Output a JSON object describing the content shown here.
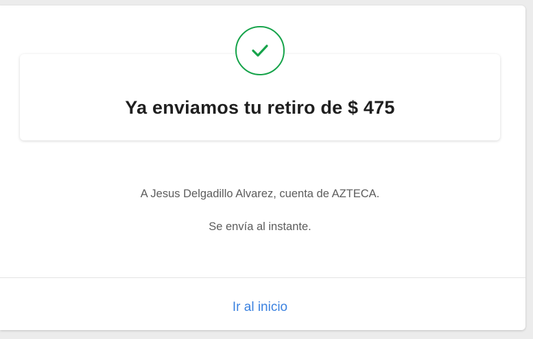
{
  "confirmation": {
    "status_icon": "check-icon",
    "title": "Ya enviamos tu retiro de $ 475",
    "recipient_text": "A Jesus Delgadillo Alvarez, cuenta de AZTECA.",
    "timing_text": "Se envía al instante."
  },
  "actions": {
    "home_link_label": "Ir al inicio"
  },
  "colors": {
    "success": "#16a34a",
    "link": "#3b82e0"
  }
}
